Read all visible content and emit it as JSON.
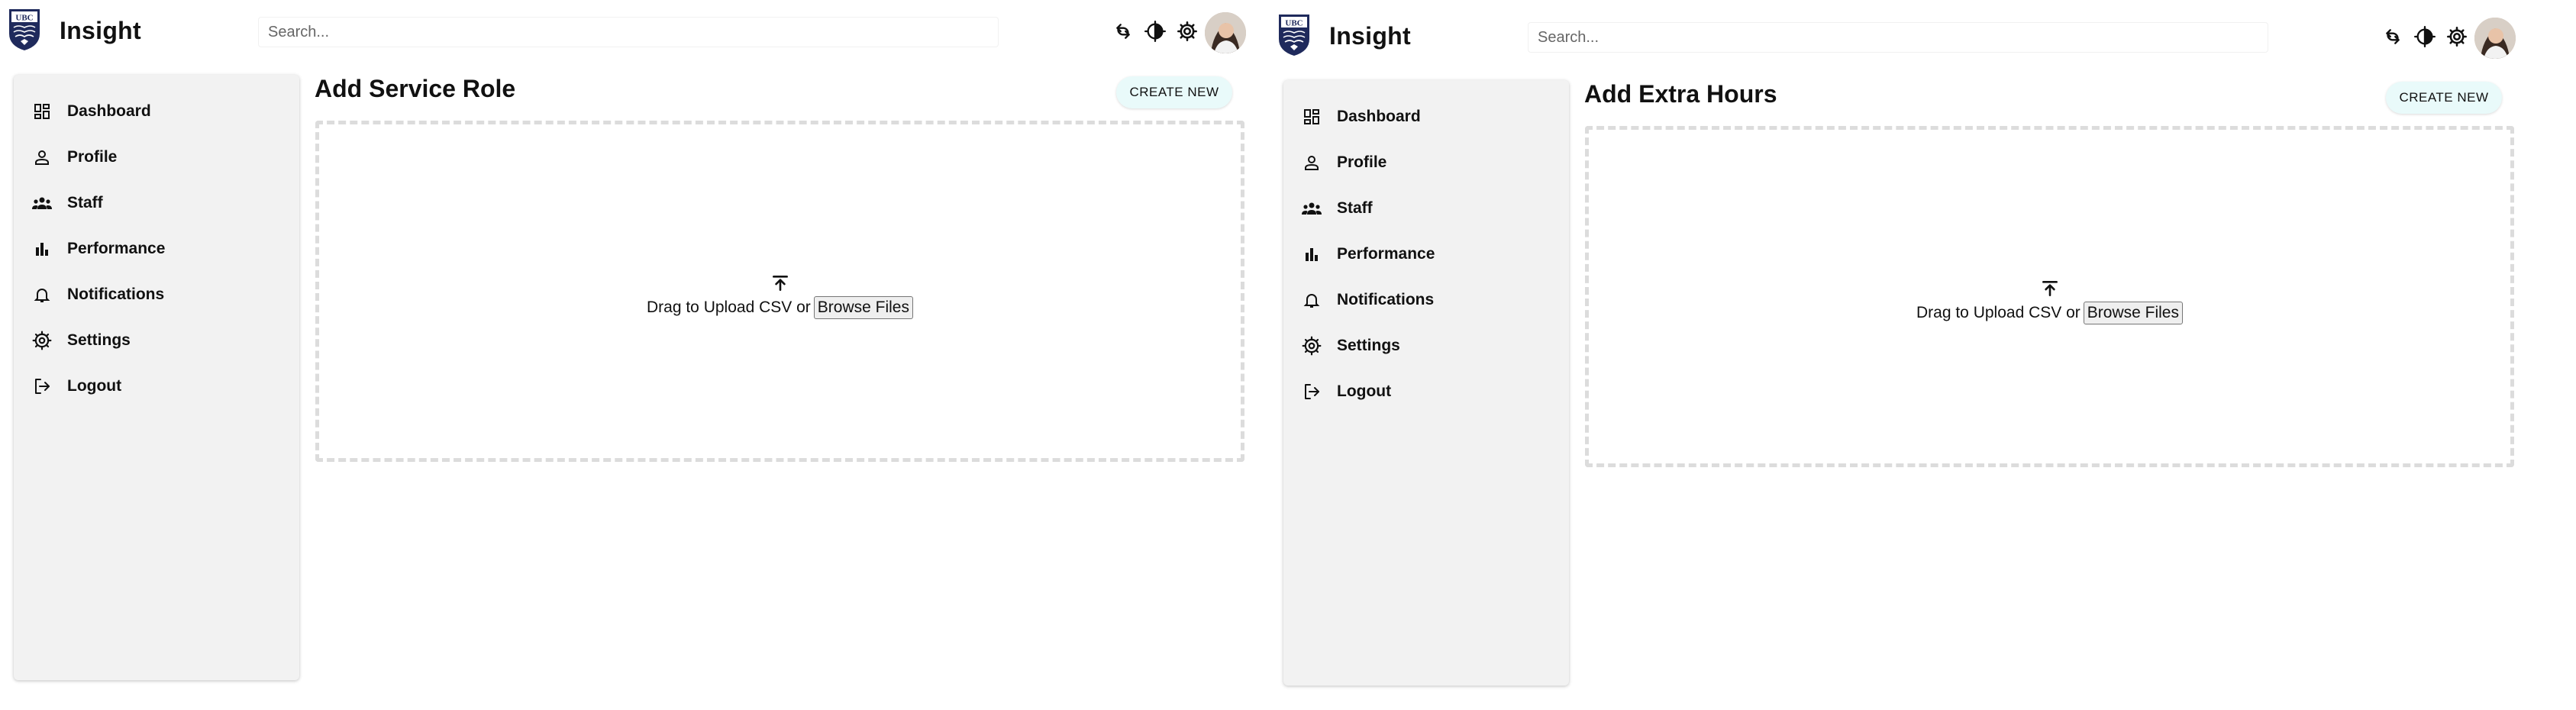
{
  "panels": [
    {
      "app_title": "Insight",
      "logo_text": "UBC",
      "search_placeholder": "Search...",
      "nav": [
        {
          "label": "Dashboard",
          "icon": "dashboard-icon"
        },
        {
          "label": "Profile",
          "icon": "profile-icon"
        },
        {
          "label": "Staff",
          "icon": "staff-icon"
        },
        {
          "label": "Performance",
          "icon": "performance-icon"
        },
        {
          "label": "Notifications",
          "icon": "bell-icon"
        },
        {
          "label": "Settings",
          "icon": "gear-icon"
        },
        {
          "label": "Logout",
          "icon": "logout-icon"
        }
      ],
      "page_title": "Add Service Role",
      "create_button": "CREATE NEW",
      "drop_text": "Drag to Upload CSV or",
      "browse_button": "Browse Files"
    },
    {
      "app_title": "Insight",
      "logo_text": "UBC",
      "search_placeholder": "Search...",
      "nav": [
        {
          "label": "Dashboard",
          "icon": "dashboard-icon"
        },
        {
          "label": "Profile",
          "icon": "profile-icon"
        },
        {
          "label": "Staff",
          "icon": "staff-icon"
        },
        {
          "label": "Performance",
          "icon": "performance-icon"
        },
        {
          "label": "Notifications",
          "icon": "bell-icon"
        },
        {
          "label": "Settings",
          "icon": "gear-icon"
        },
        {
          "label": "Logout",
          "icon": "logout-icon"
        }
      ],
      "page_title": "Add Extra Hours",
      "create_button": "CREATE NEW",
      "drop_text": "Drag to Upload CSV or",
      "browse_button": "Browse Files"
    }
  ],
  "colors": {
    "logo_navy": "#1f2a5c",
    "sidebar_bg": "#f2f2f2",
    "create_button_bg": "#e9fafa",
    "dropzone_border": "#dcdcdc"
  }
}
